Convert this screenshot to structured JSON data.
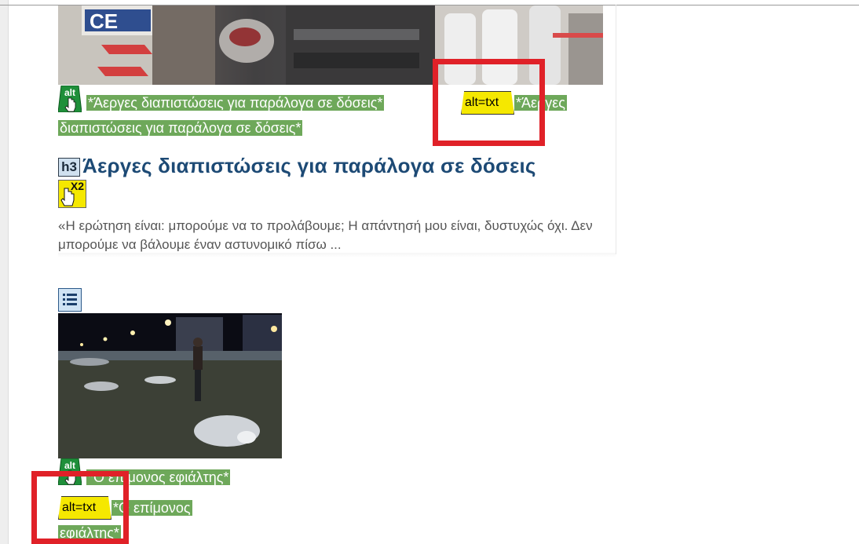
{
  "article1": {
    "alt_text_highlight_line1": "*Άεργες διαπιστώσεις για παράλογα σε δόσεις*",
    "alt_text_highlight_line2": "διαπιστώσεις για παράλογα σε δόσεις*",
    "alt_badge_label": "alt=txt",
    "alt_after_badge": "*Άεργες",
    "heading_tag": "h3",
    "heading": "Άεργες διαπιστώσεις για παράλογα σε δόσεις",
    "x2_label": "X2",
    "excerpt": "«Η ερώτηση είναι: μπορούμε να το προλάβουμε; Η απάντησή μου είναι, δυστυχώς όχι. Δεν μπορούμε να βάλουμε έναν αστυνομικό πίσω ...",
    "photo_sign_text": "CE"
  },
  "article2": {
    "alt_text_highlight_line1": "*Ο επίμονος εφιάλτης*",
    "alt_badge_label": "alt=txt",
    "alt_after_badge": "*Ο επίμονος",
    "alt_line3": "εφιάλτης*"
  },
  "flag_label": "alt"
}
